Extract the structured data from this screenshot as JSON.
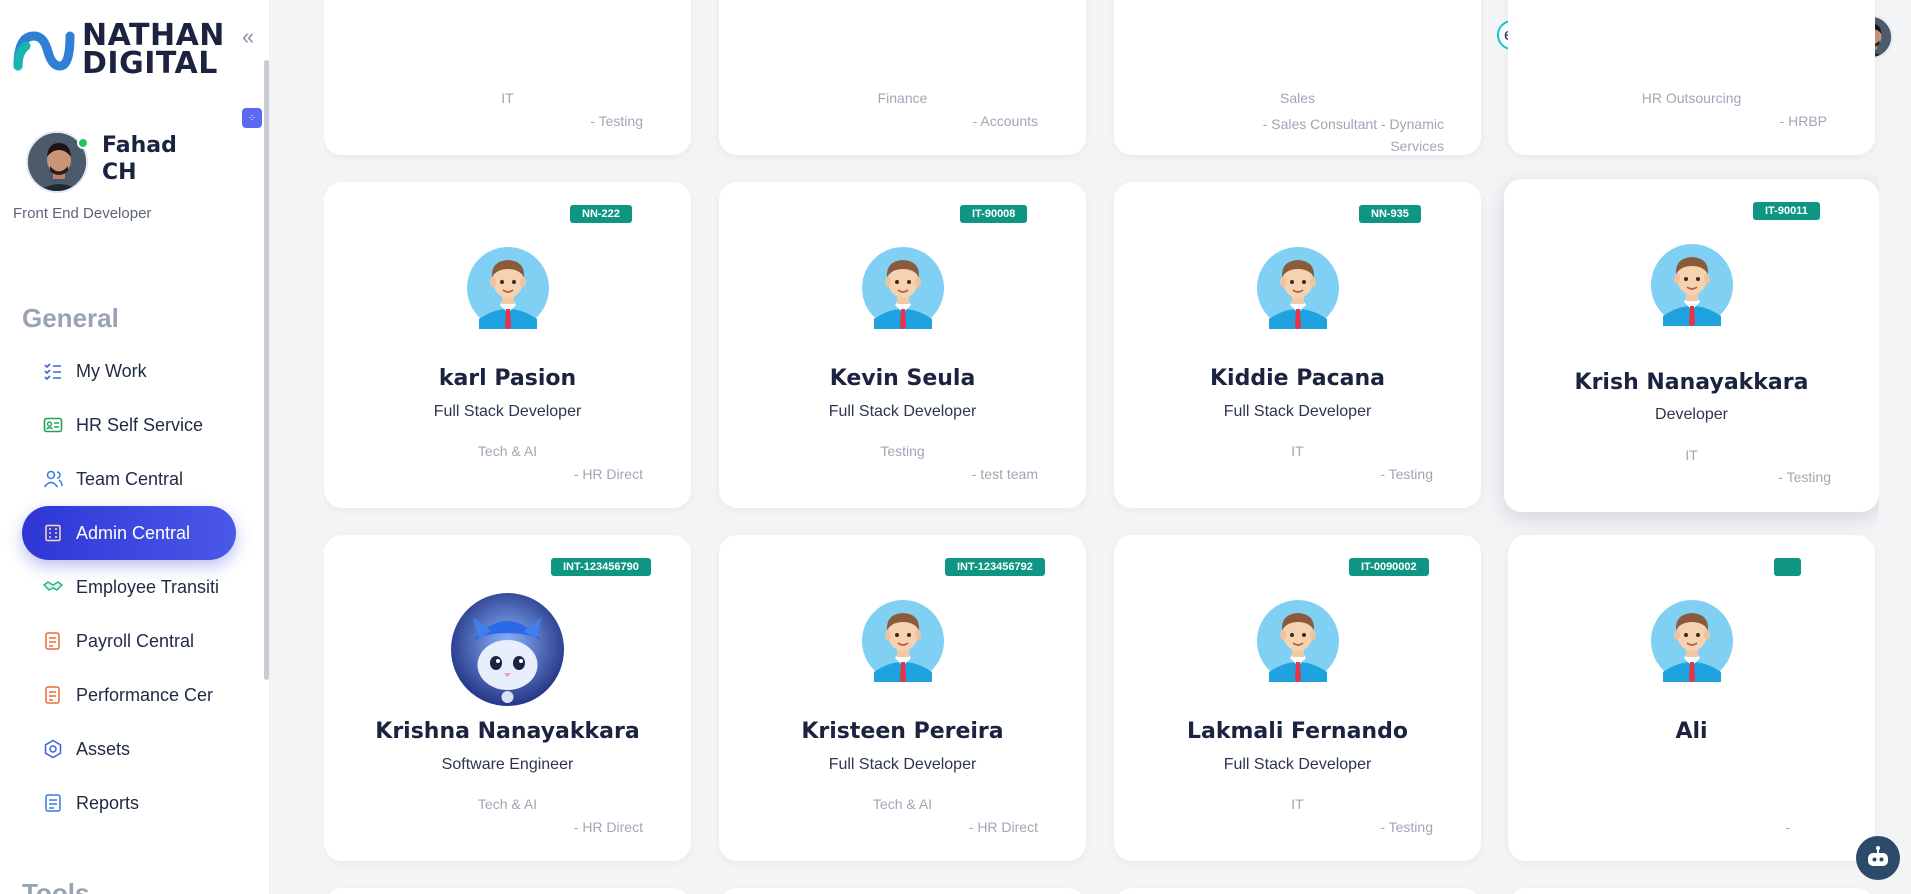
{
  "brand": {
    "line1": "NATHAN",
    "line2": "DIGITAL"
  },
  "user": {
    "name": "Fahad CH",
    "role": "Front End Developer"
  },
  "sidebar": {
    "section_general": "General",
    "section_tools": "Tools",
    "items": [
      {
        "label": "My Work",
        "icon": "checklist-icon"
      },
      {
        "label": "HR Self Service",
        "icon": "id-card-icon"
      },
      {
        "label": "Team Central",
        "icon": "team-icon"
      },
      {
        "label": "Admin Central",
        "icon": "building-icon",
        "active": true
      },
      {
        "label": "Employee Transiti",
        "icon": "handshake-icon"
      },
      {
        "label": "Payroll Central",
        "icon": "document-icon"
      },
      {
        "label": "Performance Cer",
        "icon": "document-icon"
      },
      {
        "label": "Assets",
        "icon": "hexagon-icon"
      },
      {
        "label": "Reports",
        "icon": "report-icon"
      }
    ]
  },
  "topbar": {
    "language": "en"
  },
  "cards_top_partial": [
    {
      "dept": "IT",
      "team": "- Testing"
    },
    {
      "dept": "Finance",
      "team": "- Accounts"
    },
    {
      "dept": "Sales",
      "team": "- Sales Consultant - Dynamic Services"
    },
    {
      "dept": "HR Outsourcing",
      "team": "- HRBP"
    }
  ],
  "cards_row1": [
    {
      "code": "NN-222",
      "name": "karl Pasion",
      "designation": "Full Stack Developer",
      "dept": "Tech & AI",
      "team": "- HR Direct"
    },
    {
      "code": "IT-90008",
      "name": "Kevin Seula",
      "designation": "Full Stack Developer",
      "dept": "Testing",
      "team": "- test team"
    },
    {
      "code": "NN-935",
      "name": "Kiddie Pacana",
      "designation": "Full Stack Developer",
      "dept": "IT",
      "team": "- Testing"
    },
    {
      "code": "IT-90011",
      "name": "Krish Nanayakkara",
      "designation": "Developer",
      "dept": "IT",
      "team": "- Testing"
    }
  ],
  "cards_row2": [
    {
      "code": "INT-123456790",
      "name": "Krishna Nanayakkara",
      "designation": "Software Engineer",
      "dept": "Tech & AI",
      "team": "- HR Direct"
    },
    {
      "code": "INT-123456792",
      "name": "Kristeen Pereira",
      "designation": "Full Stack Developer",
      "dept": "Tech & AI",
      "team": "- HR Direct"
    },
    {
      "code": "IT-0090002",
      "name": "Lakmali Fernando",
      "designation": "Full Stack Developer",
      "dept": "IT",
      "team": "- Testing"
    },
    {
      "code": "",
      "name": "Ali",
      "designation": "",
      "dept": "",
      "team": "-"
    }
  ],
  "colors": {
    "accent": "#2e36d6",
    "badge": "#0f9683",
    "toggle": "#16d9e8"
  }
}
